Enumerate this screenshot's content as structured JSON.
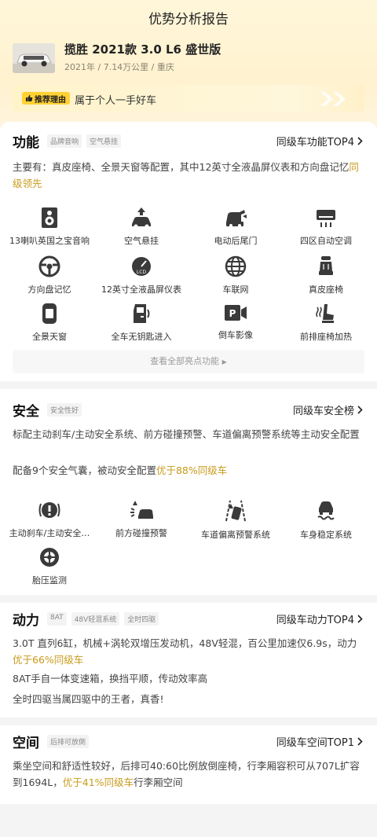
{
  "header": {
    "title": "优势分析报告"
  },
  "car": {
    "name": "揽胜 2021款 3.0 L6 盛世版",
    "meta": "2021年 / 7.14万公里 / 重庆"
  },
  "reason": {
    "tag": "推荐理由",
    "text": "属于个人一手好车"
  },
  "features": {
    "title": "功能",
    "tags": [
      "品牌音响",
      "空气悬挂"
    ],
    "link": "同级车功能TOP4",
    "desc_prefix": "主要有：真皮座椅、全景天窗等配置，其中12英寸全液晶屏仪表和方向盘记忆",
    "desc_highlight": "同级领先",
    "items": [
      {
        "label": "13喇叭英国之宝音响",
        "icon": "speaker-icon"
      },
      {
        "label": "空气悬挂",
        "icon": "air-suspension-icon"
      },
      {
        "label": "电动后尾门",
        "icon": "power-tailgate-icon"
      },
      {
        "label": "四区自动空调",
        "icon": "air-conditioner-icon"
      },
      {
        "label": "方向盘记忆",
        "icon": "steering-wheel-icon"
      },
      {
        "label": "12英寸全液晶屏仪表",
        "icon": "lcd-gauge-icon"
      },
      {
        "label": "车联网",
        "icon": "globe-icon"
      },
      {
        "label": "真皮座椅",
        "icon": "seat-icon"
      },
      {
        "label": "全景天窗",
        "icon": "sunroof-icon"
      },
      {
        "label": "全车无钥匙进入",
        "icon": "keyless-entry-icon"
      },
      {
        "label": "倒车影像",
        "icon": "parking-camera-icon"
      },
      {
        "label": "前排座椅加热",
        "icon": "heated-seat-icon"
      }
    ],
    "more": "查看全部亮点功能"
  },
  "safety": {
    "title": "安全",
    "tags": [
      "安全性好"
    ],
    "link": "同级车安全榜",
    "desc1": "标配主动刹车/主动安全系统、前方碰撞预警、车道偏离预警系统等主动安全配置",
    "desc2_prefix": "配备9个安全气囊，被动安全配置",
    "desc2_highlight": "优于88%同级车",
    "items": [
      {
        "label": "主动刹车/主动安全…",
        "icon": "brake-alert-icon"
      },
      {
        "label": "前方碰撞预警",
        "icon": "collision-warning-icon"
      },
      {
        "label": "车道偏离预警系统",
        "icon": "lane-departure-icon"
      },
      {
        "label": "车身稳定系统",
        "icon": "stability-control-icon"
      },
      {
        "label": "胎压监测",
        "icon": "tire-pressure-icon"
      }
    ]
  },
  "power": {
    "title": "动力",
    "tags": [
      "8AT",
      "48V轻混系统",
      "全时四驱"
    ],
    "link": "同级车动力TOP4",
    "desc1_prefix": "3.0T 直列6缸，机械+涡轮双增压发动机，48V轻混，百公里加速仅6.9s，动力",
    "desc1_highlight": "优于66%同级车",
    "desc2": "8AT手自一体变速箱，换挡平顺，传动效率高",
    "desc3": "全时四驱当属四驱中的王者，真香!"
  },
  "space": {
    "title": "空间",
    "tags": [
      "后排可放倒"
    ],
    "link": "同级车空间TOP1",
    "desc_prefix": "乘坐空间和舒适性较好，后排可40:60比例放倒座椅，行李厢容积可从707L扩容到1694L，",
    "desc_highlight": "优于41%同级车",
    "desc_suffix": "行李厢空间"
  },
  "colors": {
    "accent": "#ffd133",
    "highlight": "#c89a1b",
    "background": "#f4f4f4"
  }
}
